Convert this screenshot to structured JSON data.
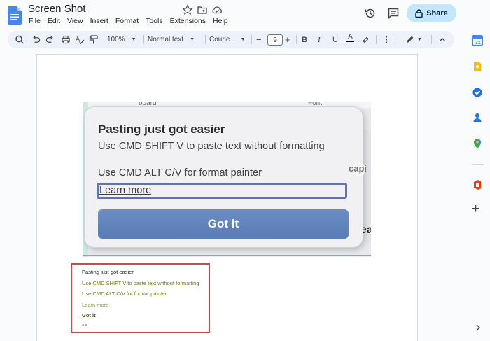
{
  "header": {
    "title": "Screen Shot",
    "menu": [
      "File",
      "Edit",
      "View",
      "Insert",
      "Format",
      "Tools",
      "Extensions",
      "Help"
    ],
    "share_label": "Share"
  },
  "toolbar": {
    "zoom": "100%",
    "style": "Normal text",
    "font": "Courie...",
    "font_size": "9",
    "minus": "−",
    "plus": "+",
    "bold": "B",
    "italic": "I",
    "underline": "U",
    "textcolor": "A"
  },
  "screenshot": {
    "bg_left_text": "board",
    "bg_right_text": "Font",
    "bg_partial": "ea",
    "watermark": "capi"
  },
  "dialog": {
    "title": "Pasting just got easier",
    "line1": "Use CMD SHIFT V to paste text without formatting",
    "line2": "Use CMD ALT C/V for format painter",
    "learn_more": "Learn more",
    "button": "Got it"
  },
  "pasted": {
    "title": "Pasting just got easier",
    "line1": "Use CMD SHIFT V to paste text without formatting",
    "line2": "Use CMD ALT C/V for format painter",
    "learn_more": "Learn more",
    "button": "Got it",
    "tail": "■ ■"
  },
  "colors": {
    "accent": "#c2e7ff",
    "button": "#5a7cb6",
    "highlight_box": "#d64545",
    "olive_text": "#7a7a00"
  }
}
